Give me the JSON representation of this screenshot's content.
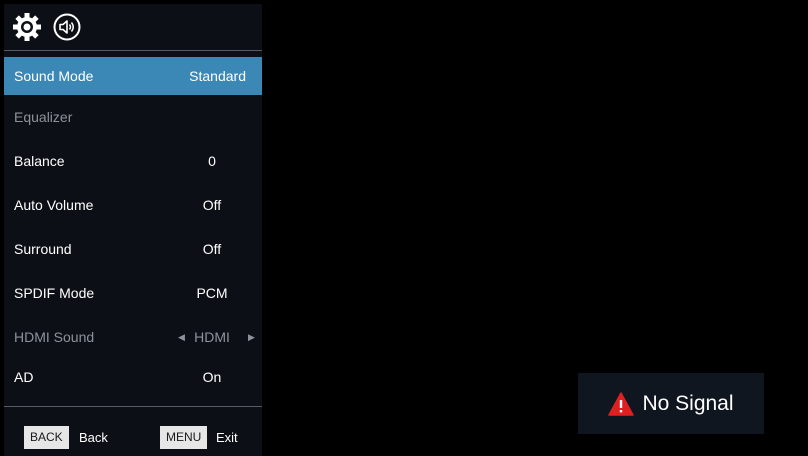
{
  "header": {
    "icons": [
      "gear-icon",
      "speaker-icon"
    ],
    "active_icon": "speaker-icon"
  },
  "menu": {
    "items": [
      {
        "label": "Sound Mode",
        "value": "Standard",
        "state": "selected"
      },
      {
        "label": "Equalizer",
        "value": "",
        "state": "disabled"
      },
      {
        "label": "Balance",
        "value": "0",
        "state": "normal"
      },
      {
        "label": "Auto Volume",
        "value": "Off",
        "state": "normal"
      },
      {
        "label": "Surround",
        "value": "Off",
        "state": "normal"
      },
      {
        "label": "SPDIF Mode",
        "value": "PCM",
        "state": "normal"
      },
      {
        "label": "HDMI Sound",
        "value": "HDMI",
        "state": "disabled"
      },
      {
        "label": "AD",
        "value": "On",
        "state": "normal"
      }
    ]
  },
  "footer": {
    "back_key": "BACK",
    "back_label": "Back",
    "menu_key": "MENU",
    "menu_label": "Exit"
  },
  "signal": {
    "text": "No Signal",
    "icon": "warning-icon"
  },
  "colors": {
    "panel": "#0c1016",
    "selected": "#3b87b5",
    "disabled_text": "#8d939b",
    "warning": "#e02020",
    "signal_box": "#0f1620"
  }
}
